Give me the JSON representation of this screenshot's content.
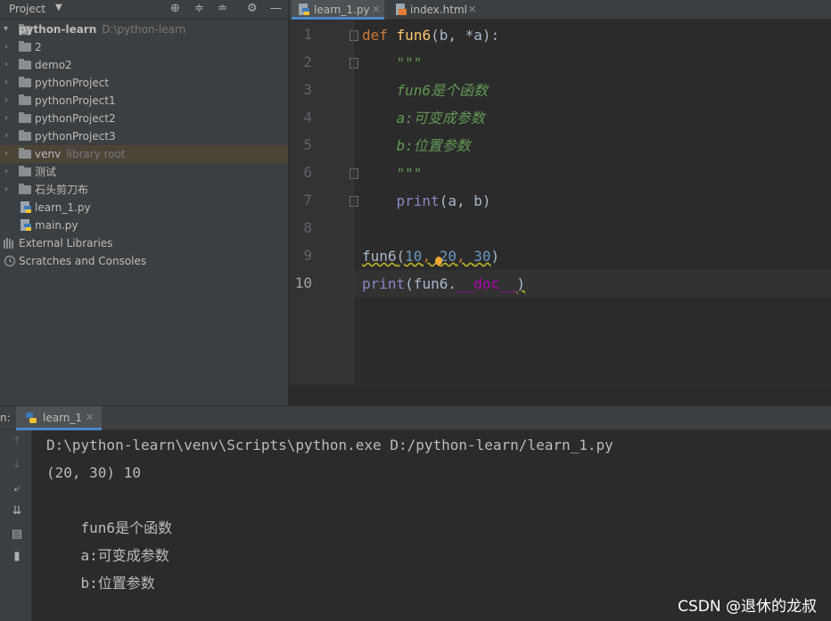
{
  "project_panel": {
    "title": "Project",
    "header_icons": [
      "locate-icon",
      "expand-all-icon",
      "collapse-all-icon",
      "gear-icon",
      "hide-icon"
    ],
    "root": {
      "name": "python-learn",
      "path": "D:\\python-learn"
    },
    "items": [
      {
        "type": "folder",
        "label": "2"
      },
      {
        "type": "folder",
        "label": "demo2"
      },
      {
        "type": "folder",
        "label": "pythonProject"
      },
      {
        "type": "folder",
        "label": "pythonProject1"
      },
      {
        "type": "folder",
        "label": "pythonProject2"
      },
      {
        "type": "folder",
        "label": "pythonProject3"
      },
      {
        "type": "folder",
        "label": "venv",
        "hint": "library root",
        "selected": true
      },
      {
        "type": "folder",
        "label": "测试"
      },
      {
        "type": "folder",
        "label": "石头剪刀布"
      },
      {
        "type": "file",
        "label": "learn_1.py"
      },
      {
        "type": "file",
        "label": "main.py"
      }
    ],
    "external_libraries": "External Libraries",
    "scratches": "Scratches and Consoles"
  },
  "editor": {
    "tabs": [
      {
        "label": "learn_1.py",
        "active": true
      },
      {
        "label": "index.html",
        "active": false
      }
    ],
    "line_numbers": [
      "1",
      "2",
      "3",
      "4",
      "5",
      "6",
      "7",
      "8",
      "9",
      "10"
    ],
    "current_line": "10",
    "code": {
      "l1_def": "def",
      "l1_name": "fun6",
      "l1_params": "(b, *a):",
      "l2": "\"\"\"",
      "l3": "fun6是个函数",
      "l4": "a:可变成参数",
      "l5": "b:位置参数",
      "l6": "\"\"\"",
      "l7_print": "print",
      "l7_args": "(a, b)",
      "l9_name": "fun6",
      "l9_open": "(",
      "l9_a": "10",
      "l9_sep1": ", ",
      "l9_b": "20",
      "l9_sep2": ", ",
      "l9_c": "30",
      "l9_close": ")",
      "l10_print": "print",
      "l10_mid": "(fun6.",
      "l10_doc": "__doc__",
      "l10_close": ")"
    }
  },
  "run_panel": {
    "prefix": "n:",
    "tab_label": "learn_1",
    "toolbar_icons": [
      "up-arrow-icon",
      "down-arrow-icon",
      "soft-wrap-icon",
      "scroll-to-end-icon",
      "print-icon",
      "trash-icon"
    ],
    "console_lines": [
      "D:\\python-learn\\venv\\Scripts\\python.exe D:/python-learn/learn_1.py",
      "(20, 30) 10",
      "",
      "    fun6是个函数",
      "    a:可变成参数",
      "    b:位置参数"
    ]
  },
  "watermark": "CSDN @退休的龙叔"
}
